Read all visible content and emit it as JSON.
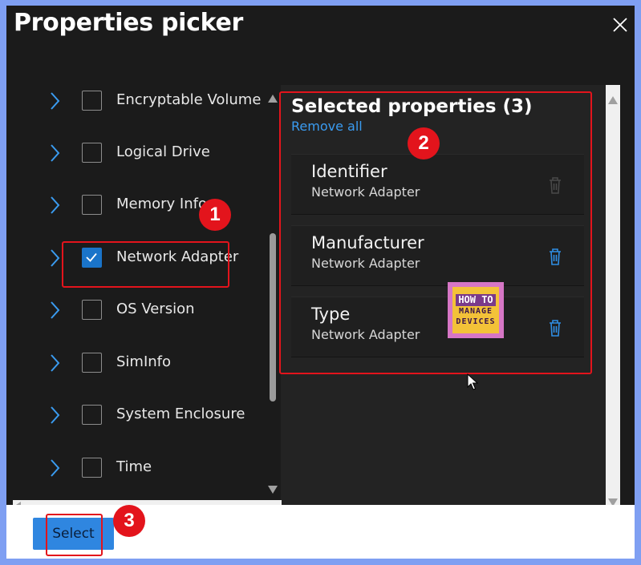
{
  "dialog": {
    "title": "Properties picker",
    "close_icon": "close-icon"
  },
  "left_list": {
    "items": [
      {
        "label": "Encryptable Volume",
        "checked": false
      },
      {
        "label": "Logical Drive",
        "checked": false
      },
      {
        "label": "Memory Info",
        "checked": false
      },
      {
        "label": "Network Adapter",
        "checked": true
      },
      {
        "label": "OS Version",
        "checked": false
      },
      {
        "label": "SimInfo",
        "checked": false
      },
      {
        "label": "System Enclosure",
        "checked": false
      },
      {
        "label": "Time",
        "checked": false
      }
    ]
  },
  "selected_panel": {
    "title": "Selected properties (3)",
    "remove_all": "Remove all",
    "items": [
      {
        "name": "Identifier",
        "category": "Network Adapter",
        "delete_enabled": false
      },
      {
        "name": "Manufacturer",
        "category": "Network Adapter",
        "delete_enabled": true
      },
      {
        "name": "Type",
        "category": "Network Adapter",
        "delete_enabled": true
      }
    ]
  },
  "footer": {
    "select_label": "Select"
  },
  "annotations": {
    "markers": [
      "1",
      "2",
      "3"
    ],
    "highlight_color": "#e3141c"
  },
  "watermark": {
    "top": "HOW TO",
    "line1": "MANAGE",
    "line2": "DEVICES"
  },
  "colors": {
    "accent": "#1a74c9",
    "link": "#3a9bf0",
    "background": "#1b1b1b",
    "frame": "#7f9ff2"
  }
}
